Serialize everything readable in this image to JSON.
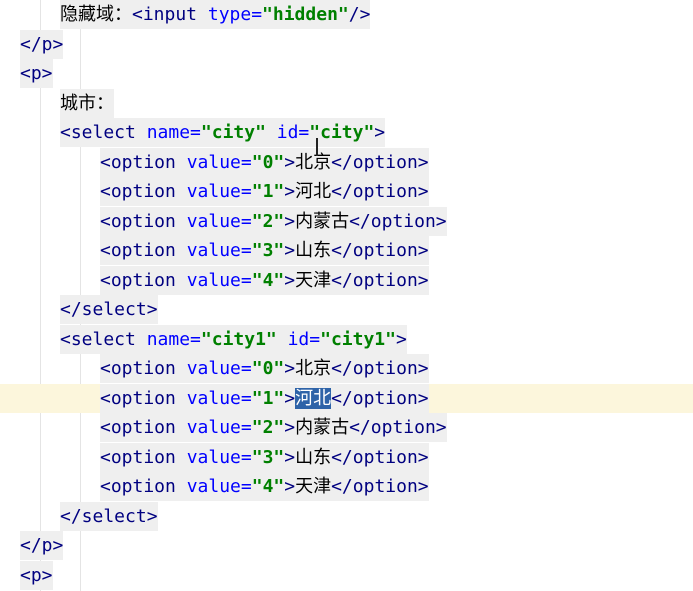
{
  "editor": {
    "lines": [
      [
        {
          "t": "txt",
          "v": "隐藏域："
        },
        {
          "t": "tag",
          "v": "<input "
        },
        {
          "t": "attr",
          "v": "type="
        },
        {
          "t": "val",
          "v": "\"hidden\""
        },
        {
          "t": "tag",
          "v": "/>"
        }
      ],
      [
        {
          "t": "tag",
          "v": "</p>"
        }
      ],
      [
        {
          "t": "tag",
          "v": "<p>"
        }
      ],
      [
        {
          "t": "txt",
          "v": "城市："
        }
      ],
      [
        {
          "t": "tag",
          "v": "<select "
        },
        {
          "t": "attr",
          "v": "name="
        },
        {
          "t": "val",
          "v": "\"city\" "
        },
        {
          "t": "attr",
          "v": "id="
        },
        {
          "t": "val",
          "v": "\"city\""
        },
        {
          "t": "tag",
          "v": ">"
        }
      ],
      [
        {
          "t": "tag",
          "v": "<option "
        },
        {
          "t": "attr",
          "v": "value="
        },
        {
          "t": "val",
          "v": "\"0\""
        },
        {
          "t": "tag",
          "v": ">"
        },
        {
          "t": "txt",
          "v": "北京"
        },
        {
          "t": "tag",
          "v": "</option>"
        }
      ],
      [
        {
          "t": "tag",
          "v": "<option "
        },
        {
          "t": "attr",
          "v": "value="
        },
        {
          "t": "val",
          "v": "\"1\""
        },
        {
          "t": "tag",
          "v": ">"
        },
        {
          "t": "txt",
          "v": "河北"
        },
        {
          "t": "tag",
          "v": "</option>"
        }
      ],
      [
        {
          "t": "tag",
          "v": "<option "
        },
        {
          "t": "attr",
          "v": "value="
        },
        {
          "t": "val",
          "v": "\"2\""
        },
        {
          "t": "tag",
          "v": ">"
        },
        {
          "t": "txt",
          "v": "内蒙古"
        },
        {
          "t": "tag",
          "v": "</option>"
        }
      ],
      [
        {
          "t": "tag",
          "v": "<option "
        },
        {
          "t": "attr",
          "v": "value="
        },
        {
          "t": "val",
          "v": "\"3\""
        },
        {
          "t": "tag",
          "v": ">"
        },
        {
          "t": "txt",
          "v": "山东"
        },
        {
          "t": "tag",
          "v": "</option>"
        }
      ],
      [
        {
          "t": "tag",
          "v": "<option "
        },
        {
          "t": "attr",
          "v": "value="
        },
        {
          "t": "val",
          "v": "\"4\""
        },
        {
          "t": "tag",
          "v": ">"
        },
        {
          "t": "txt",
          "v": "天津"
        },
        {
          "t": "tag",
          "v": "</option>"
        }
      ],
      [
        {
          "t": "tag",
          "v": "</select>"
        }
      ],
      [
        {
          "t": "tag",
          "v": "<select "
        },
        {
          "t": "attr",
          "v": "name="
        },
        {
          "t": "val",
          "v": "\"city1\" "
        },
        {
          "t": "attr",
          "v": "id="
        },
        {
          "t": "val",
          "v": "\"city1\""
        },
        {
          "t": "tag",
          "v": ">"
        }
      ],
      [
        {
          "t": "tag",
          "v": "<option "
        },
        {
          "t": "attr",
          "v": "value="
        },
        {
          "t": "val",
          "v": "\"0\""
        },
        {
          "t": "tag",
          "v": ">"
        },
        {
          "t": "txt",
          "v": "北京"
        },
        {
          "t": "tag",
          "v": "</option>"
        }
      ],
      [
        {
          "t": "tag",
          "v": "<option "
        },
        {
          "t": "attr",
          "v": "value="
        },
        {
          "t": "val",
          "v": "\"1\""
        },
        {
          "t": "tag",
          "v": ">"
        },
        {
          "t": "sel",
          "v": "河北"
        },
        {
          "t": "tag",
          "v": "</option>"
        }
      ],
      [
        {
          "t": "tag",
          "v": "<option "
        },
        {
          "t": "attr",
          "v": "value="
        },
        {
          "t": "val",
          "v": "\"2\""
        },
        {
          "t": "tag",
          "v": ">"
        },
        {
          "t": "txt",
          "v": "内蒙古"
        },
        {
          "t": "tag",
          "v": "</option>"
        }
      ],
      [
        {
          "t": "tag",
          "v": "<option "
        },
        {
          "t": "attr",
          "v": "value="
        },
        {
          "t": "val",
          "v": "\"3\""
        },
        {
          "t": "tag",
          "v": ">"
        },
        {
          "t": "txt",
          "v": "山东"
        },
        {
          "t": "tag",
          "v": "</option>"
        }
      ],
      [
        {
          "t": "tag",
          "v": "<option "
        },
        {
          "t": "attr",
          "v": "value="
        },
        {
          "t": "val",
          "v": "\"4\""
        },
        {
          "t": "tag",
          "v": ">"
        },
        {
          "t": "txt",
          "v": "天津"
        },
        {
          "t": "tag",
          "v": "</option>"
        }
      ],
      [
        {
          "t": "tag",
          "v": "</select>"
        }
      ],
      [
        {
          "t": "tag",
          "v": "</p>"
        }
      ],
      [
        {
          "t": "tag",
          "v": "<p>"
        }
      ]
    ],
    "current_line": 13,
    "selected_text": "河北",
    "colors": {
      "tag": "#000080",
      "attribute": "#0000ff",
      "string": "#008000",
      "current_line_bg": "#fcf6dc",
      "selection_bg": "#2e63a8",
      "tag_block_bg": "#efefef"
    }
  }
}
